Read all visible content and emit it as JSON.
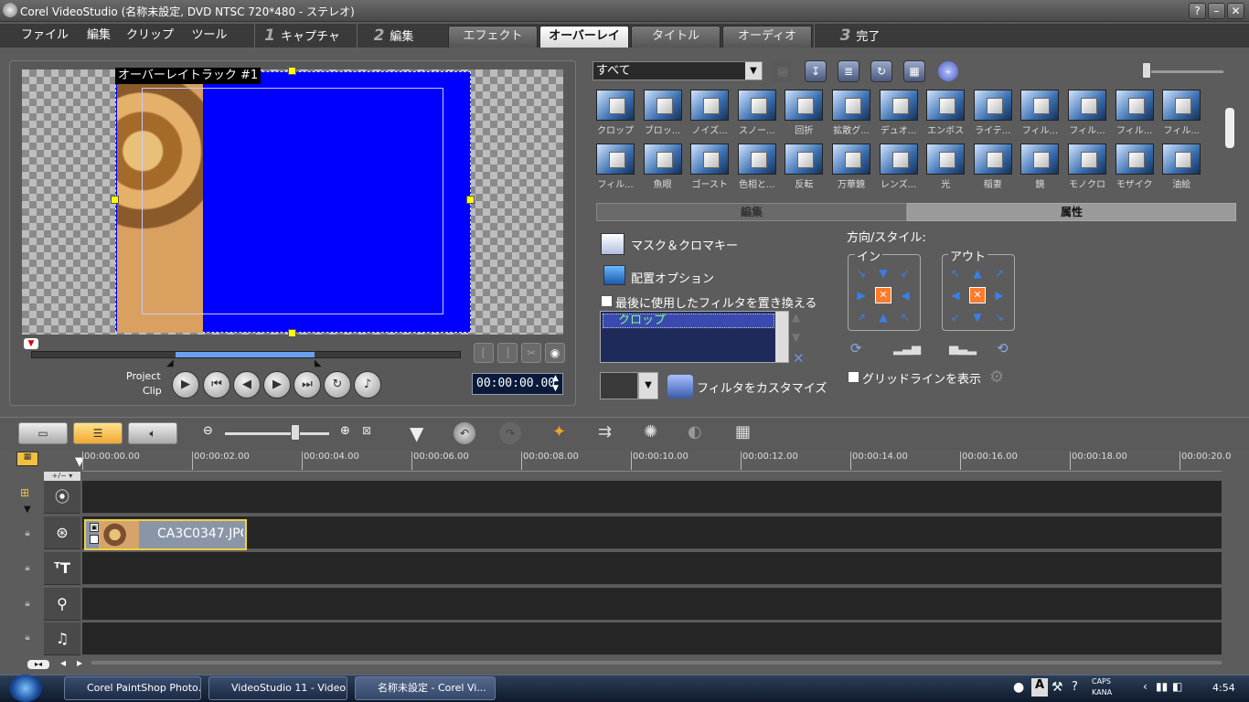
{
  "window": {
    "title": "Corel VideoStudio (名称未設定, DVD NTSC 720*480 - ステレオ)",
    "help": "?",
    "minimize": "–",
    "close": "✕"
  },
  "menu": {
    "items": [
      "ファイル",
      "編集",
      "クリップ",
      "ツール"
    ]
  },
  "steps": [
    {
      "num": "1",
      "label": "キャプチャ"
    },
    {
      "num": "2",
      "label": "編集"
    },
    {
      "num": "3",
      "label": "完了"
    }
  ],
  "edit_tabs": [
    "エフェクト",
    "オーバーレイ",
    "タイトル",
    "オーディオ"
  ],
  "active_edit_tab": "オーバーレイ",
  "preview": {
    "overlay_label": "オーバーレイトラック #1",
    "project": "Project",
    "clip": "Clip",
    "timecode": "00:00:00.00"
  },
  "library": {
    "category": "すべて",
    "filters_row1": [
      "クロップ",
      "ブロッ...",
      "ノイズ...",
      "スノー...",
      "回折",
      "拡散グ...",
      "デュオ...",
      "エンボス",
      "ライテ...",
      "フィル...",
      "フィル...",
      "フィル...",
      "フィル..."
    ],
    "filters_row2": [
      "フィル...",
      "魚眼",
      "ゴースト",
      "色相と...",
      "反転",
      "万華鏡",
      "レンズ...",
      "光",
      "稲妻",
      "鏡",
      "モノクロ",
      "モザイク",
      "油絵"
    ]
  },
  "properties": {
    "tab_edit": "編集",
    "tab_attr": "属性",
    "mask": "マスク＆クロマキー",
    "placement": "配置オプション",
    "replace_last": "最後に使用したフィルタを置き換える",
    "filter_item": "クロップ",
    "customize": "フィルタをカスタマイズ",
    "direction_style": "方向/スタイル:",
    "in": "イン",
    "out": "アウト",
    "gridlines": "グリッドラインを表示"
  },
  "timeline": {
    "ticks": [
      "00:00:00.00",
      "00:00:02.00",
      "00:00:04.00",
      "00:00:06.00",
      "00:00:08.00",
      "00:00:10.00",
      "00:00:12.00",
      "00:00:14.00",
      "00:00:16.00",
      "00:00:18.00",
      "00:00:20.0"
    ],
    "clip_name": "CA3C0347.JPG"
  },
  "taskbar": {
    "items": [
      "Corel PaintShop Photo...",
      "VideoStudio 11 - Video...",
      "名称未設定 - Corel Vi..."
    ],
    "clock": "4:54",
    "caps": "CAPS",
    "kana": "KANA"
  },
  "colors": {
    "overlay_blue": "#0000ff",
    "accent_yellow": "#ffff00",
    "active_filter": "#3a4ab0"
  }
}
